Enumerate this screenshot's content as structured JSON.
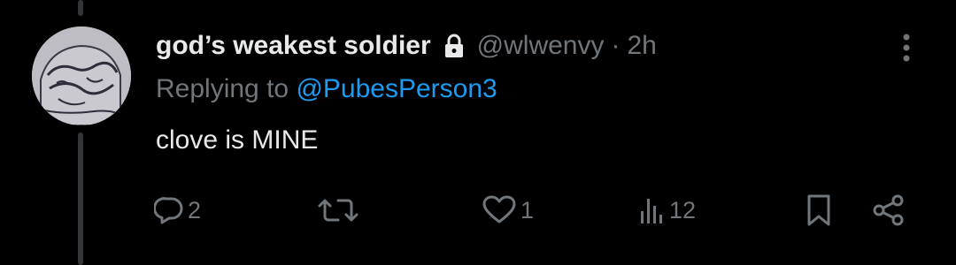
{
  "tweet": {
    "display_name": "god’s weakest soldier",
    "handle": "@wlwenvy",
    "separator": "·",
    "time": "2h",
    "replying_prefix": "Replying to ",
    "replying_to": "@PubesPerson3",
    "text": "clove is MINE"
  },
  "actions": {
    "reply_count": "2",
    "like_count": "1",
    "views_count": "12"
  },
  "icons": {
    "lock": "lock-icon",
    "more": "more-vertical-icon",
    "reply": "reply-icon",
    "repost": "repost-icon",
    "like": "heart-icon",
    "views": "views-icon",
    "bookmark": "bookmark-icon",
    "share": "share-icon"
  },
  "colors": {
    "background": "#000000",
    "primary_text": "#e7e9ea",
    "secondary_text": "#71767b",
    "link": "#1d9bf0",
    "thread_line": "#333639"
  }
}
